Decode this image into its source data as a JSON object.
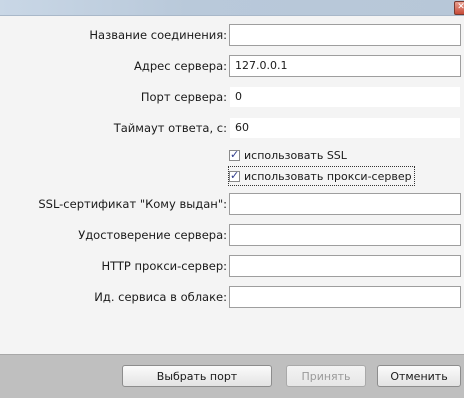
{
  "window": {
    "close_symbol": "✕"
  },
  "form": {
    "fields": [
      {
        "label": "Название соединения:",
        "value": ""
      },
      {
        "label": "Адрес сервера:",
        "value": "127.0.0.1"
      },
      {
        "label": "Порт сервера:",
        "value": "0"
      },
      {
        "label": "Таймаут ответа, с:",
        "value": "60"
      }
    ],
    "checkboxes": [
      {
        "label": "использовать SSL",
        "checked": true
      },
      {
        "label": "использовать прокси-сервер",
        "checked": true
      }
    ],
    "fields2": [
      {
        "label": "SSL-сертификат \"Кому выдан\":",
        "value": ""
      },
      {
        "label": "Удостоверение сервера:",
        "value": ""
      },
      {
        "label": "HTTP прокси-сервер:",
        "value": ""
      },
      {
        "label": "Ид. сервиса в облаке:",
        "value": ""
      }
    ],
    "check_mark": "✓"
  },
  "footer": {
    "select_port": "Выбрать порт",
    "accept": "Принять",
    "cancel": "Отменить"
  },
  "colors": {
    "content_bg": "#f4f4f4",
    "footer_bg": "#bfbfbf",
    "titlebar_bg": "#c9d7e6"
  }
}
